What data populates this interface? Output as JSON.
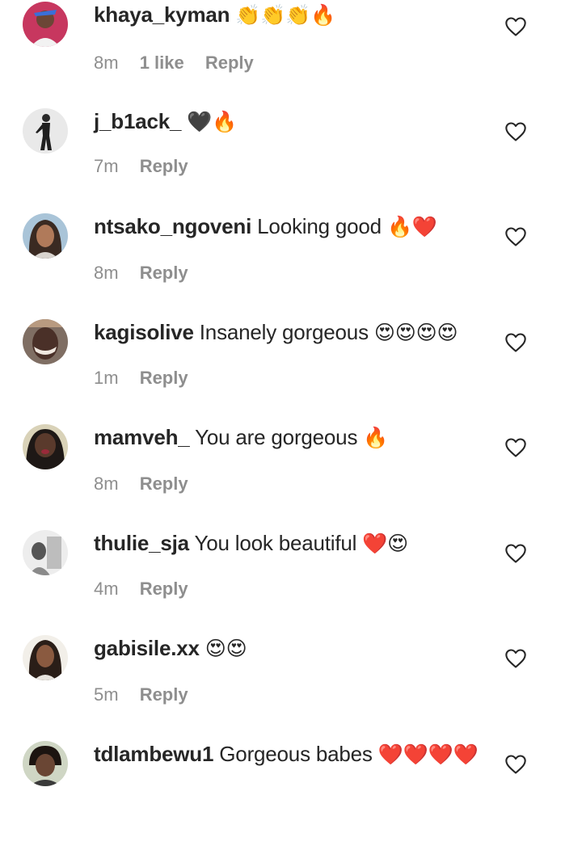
{
  "colors": {
    "text": "#262626",
    "meta": "#8e8e8e",
    "fire": "#f26b1d",
    "heart_red": "#e0202e",
    "heart_black": "#111111",
    "face_yellow": "#f8c43a"
  },
  "comments": [
    {
      "username": "khaya_kyman",
      "text": "",
      "emojis": "👏👏👏🔥",
      "time": "8m",
      "likes": "1 like",
      "reply": "Reply",
      "avatar_color": "#c7375f"
    },
    {
      "username": "j_b1ack_",
      "text": "",
      "emojis": "🖤🔥",
      "time": "7m",
      "likes": "",
      "reply": "Reply",
      "avatar_color": "#d9d9d9"
    },
    {
      "username": "ntsako_ngoveni",
      "text": "Looking good",
      "emojis": "🔥❤️",
      "time": "8m",
      "likes": "",
      "reply": "Reply",
      "avatar_color": "#7a4e3a"
    },
    {
      "username": "kagisolive",
      "text": "Insanely gorgeous",
      "emojis": "😍😍😍😍",
      "time": "1m",
      "likes": "",
      "reply": "Reply",
      "avatar_color": "#4a3a35"
    },
    {
      "username": "mamveh_",
      "text": "You are gorgeous",
      "emojis": "🔥",
      "time": "8m",
      "likes": "",
      "reply": "Reply",
      "avatar_color": "#3b3330"
    },
    {
      "username": "thulie_sja",
      "text": "You look beautiful",
      "emojis": "❤️😍",
      "time": "4m",
      "likes": "",
      "reply": "Reply",
      "avatar_color": "#9a9a9a"
    },
    {
      "username": "gabisile.xx",
      "text": "",
      "emojis": "😍😍",
      "time": "5m",
      "likes": "",
      "reply": "Reply",
      "avatar_color": "#e6e2dc"
    },
    {
      "username": "tdlambewu1",
      "text": "Gorgeous babes",
      "emojis": "❤️❤️❤️❤️",
      "time": "",
      "likes": "",
      "reply": "",
      "avatar_color": "#5a4a40"
    }
  ]
}
